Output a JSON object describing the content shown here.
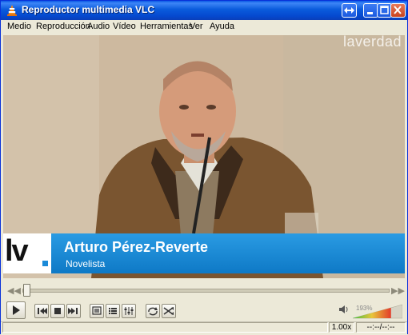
{
  "window": {
    "title": "Reproductor multimedia VLC"
  },
  "menu": {
    "items": [
      "Medio",
      "Reproducción",
      "Audio",
      "Vídeo",
      "Herramientas",
      "Ver",
      "Ayuda"
    ]
  },
  "video": {
    "watermark": "laverdad",
    "lower_third": {
      "logo_text": "lv",
      "name": "Arturo Pérez-Reverte",
      "role": "Novelista"
    }
  },
  "playback": {
    "progress": 0.01,
    "volume_label": "193%",
    "volume_level": 0.77
  },
  "status": {
    "speed": "1.00x",
    "time": "--:--/--:--"
  },
  "icons": {
    "title": "vlc-cone-icon",
    "play": "play-icon",
    "prev": "previous-icon",
    "stop": "stop-icon",
    "next": "next-icon",
    "fullscreen": "fullscreen-icon",
    "playlist": "playlist-icon",
    "extended": "extended-settings-icon",
    "loop": "loop-icon",
    "shuffle": "shuffle-icon",
    "volume": "speaker-icon"
  },
  "colors": {
    "titlebar": "#0a5bdc",
    "lower_third": "#1b8ad8",
    "volume_low": "#3fbf3f",
    "volume_high": "#e33b2a"
  }
}
